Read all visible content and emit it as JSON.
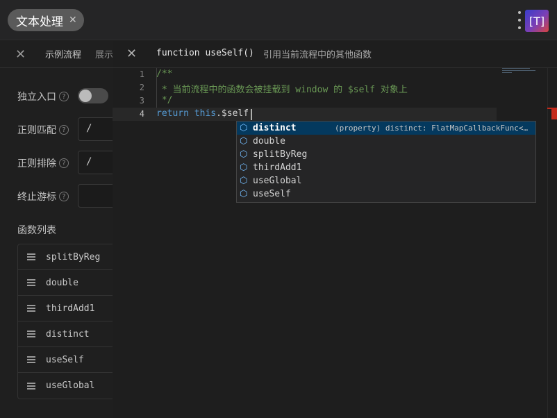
{
  "app": {
    "title": "文本处理",
    "logo_text": "[T]"
  },
  "left": {
    "tabs": [
      "示例流程",
      "展示"
    ],
    "fields": {
      "standalone_entry": "独立入口",
      "regex_match": "正则匹配",
      "regex_match_value": "/",
      "regex_exclude": "正则排除",
      "regex_exclude_value": "/",
      "stop_cursor": "终止游标",
      "stop_cursor_value": "",
      "help_mark": "?"
    },
    "standalone_enabled": false,
    "function_list_title": "函数列表",
    "functions": [
      "splitByReg",
      "double",
      "thirdAdd1",
      "distinct",
      "useSelf",
      "useGlobal"
    ]
  },
  "editor": {
    "signature": "function useSelf()",
    "description": "引用当前流程中的其他函数",
    "line_numbers": [
      "1",
      "2",
      "3",
      "4"
    ],
    "lines": {
      "l1": "/**",
      "l2": " * 当前流程中的函数会被挂载到 window 的 $self 对象上",
      "l3": " */",
      "l4_kw1": "return",
      "l4_kw2": "this",
      "l4_rest": ".$self."
    },
    "current_line": 4
  },
  "suggest": {
    "icon": "property-cube-icon",
    "items": [
      "distinct",
      "double",
      "splitByReg",
      "thirdAdd1",
      "useGlobal",
      "useSelf"
    ],
    "selected_detail": "(property) distinct: FlatMapCallbackFunc<…"
  },
  "colors": {
    "accent_selection": "#04395e",
    "keyword": "#569cd6",
    "comment": "#6a9955",
    "error_marker": "#c42b1c"
  }
}
